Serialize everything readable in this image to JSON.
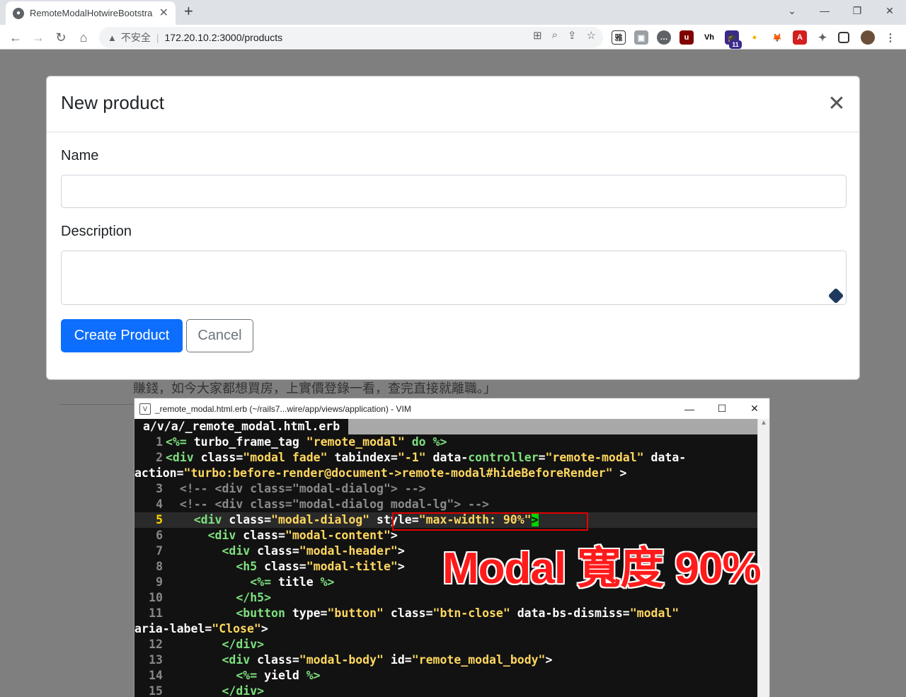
{
  "browser": {
    "tab_title": "RemoteModalHotwireBootstra",
    "new_tab": "+",
    "insecure_label": "不安全",
    "url": "172.20.10.2:3000/products",
    "ext_badge": "11"
  },
  "page": {
    "background_text": "賺錢，如今大家都想買房，上實價登錄一看，查完直接就離職。」"
  },
  "modal": {
    "title": "New product",
    "name_label": "Name",
    "name_value": "",
    "description_label": "Description",
    "description_value": "",
    "submit_label": "Create Product",
    "cancel_label": "Cancel"
  },
  "vim": {
    "window_title": "_remote_modal.html.erb (~/rails7...wire/app/views/application) - VIM",
    "tab_label": "a/v/a/_remote_modal.html.erb"
  },
  "annotation": "Modal 寬度 90%"
}
